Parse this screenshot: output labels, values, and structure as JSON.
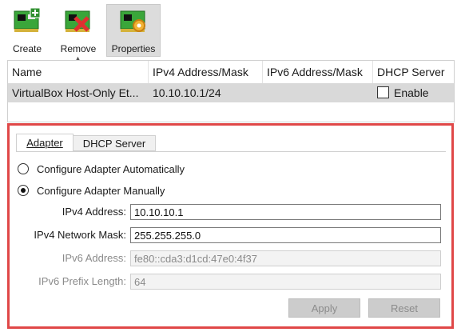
{
  "toolbar": {
    "create_label": "Create",
    "remove_label": "Remove",
    "properties_label": "Properties"
  },
  "list": {
    "columns": [
      "Name",
      "IPv4 Address/Mask",
      "IPv6 Address/Mask",
      "DHCP Server"
    ],
    "rows": [
      {
        "name": "VirtualBox Host-Only Et...",
        "ipv4": "10.10.10.1/24",
        "ipv6": "",
        "dhcp": "Enable",
        "dhcp_checked": false
      }
    ]
  },
  "tabs": {
    "adapter": "Adapter",
    "dhcp": "DHCP Server"
  },
  "adapter": {
    "auto_label": "Configure Adapter Automatically",
    "manual_label": "Configure Adapter Manually",
    "mode": "manual",
    "ipv4_address_label": "IPv4 Address:",
    "ipv4_address_value": "10.10.10.1",
    "ipv4_mask_label": "IPv4 Network Mask:",
    "ipv4_mask_value": "255.255.255.0",
    "ipv6_address_label": "IPv6 Address:",
    "ipv6_address_value": "fe80::cda3:d1cd:47e0:4f37",
    "ipv6_prefix_label": "IPv6 Prefix Length:",
    "ipv6_prefix_value": "64"
  },
  "buttons": {
    "apply": "Apply",
    "reset": "Reset"
  },
  "colors": {
    "highlight_border": "#e04848",
    "selected_row": "#d9d9d9"
  }
}
